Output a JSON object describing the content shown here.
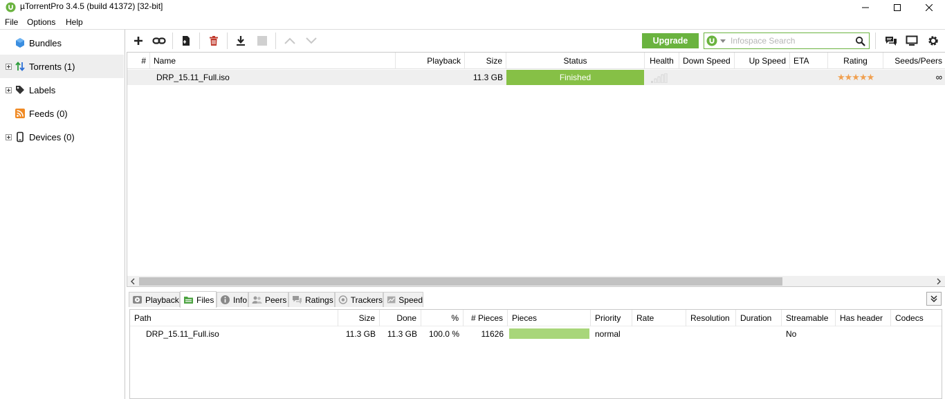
{
  "window": {
    "title": "µTorrentPro 3.4.5  (build 41372) [32-bit]",
    "controls": [
      "minimize",
      "maximize",
      "close"
    ]
  },
  "menu": [
    "File",
    "Options",
    "Help"
  ],
  "sidebar": {
    "items": [
      {
        "label": "Bundles",
        "icon": "bundles-icon"
      },
      {
        "label": "Torrents (1)",
        "icon": "torrents-icon"
      },
      {
        "label": "Labels",
        "icon": "labels-icon"
      },
      {
        "label": "Feeds (0)",
        "icon": "rss-icon"
      },
      {
        "label": "Devices (0)",
        "icon": "devices-icon"
      }
    ]
  },
  "toolbar": {
    "buttons": [
      "add-torrent",
      "add-from-url",
      "create-torrent",
      "remove",
      "start",
      "stop",
      "move-up",
      "move-down"
    ],
    "upgrade_label": "Upgrade",
    "search_placeholder": "Infospace Search",
    "right_icons": [
      "chat-icon",
      "remote-icon",
      "settings-icon"
    ]
  },
  "torrents": {
    "columns": [
      "#",
      "Name",
      "Playback",
      "Size",
      "Status",
      "Health",
      "Down Speed",
      "Up Speed",
      "ETA",
      "Rating",
      "Seeds/Peers"
    ],
    "rows": [
      {
        "num": "",
        "name": "DRP_15.11_Full.iso",
        "playback": "",
        "size": "11.3 GB",
        "status": "Finished",
        "health": "",
        "down": "",
        "up": "",
        "eta": "",
        "rating": "★★★★★",
        "seeds": "∞"
      }
    ],
    "status_color": "#86c046"
  },
  "tabs": [
    {
      "label": "Playback",
      "icon": "playback-icon"
    },
    {
      "label": "Files",
      "icon": "files-icon",
      "active": true
    },
    {
      "label": "Info",
      "icon": "info-icon"
    },
    {
      "label": "Peers",
      "icon": "peers-icon"
    },
    {
      "label": "Ratings",
      "icon": "ratings-icon"
    },
    {
      "label": "Trackers",
      "icon": "trackers-icon"
    },
    {
      "label": "Speed",
      "icon": "speed-icon"
    }
  ],
  "files": {
    "columns": [
      "Path",
      "Size",
      "Done",
      "%",
      "# Pieces",
      "Pieces",
      "Priority",
      "Rate",
      "Resolution",
      "Duration",
      "Streamable",
      "Has header",
      "Codecs"
    ],
    "rows": [
      {
        "path": "DRP_15.11_Full.iso",
        "size": "11.3 GB",
        "done": "11.3 GB",
        "pct": "100.0 %",
        "npieces": "11626",
        "pieces_fraction": 1.0,
        "priority": "normal",
        "rate": "",
        "resolution": "",
        "duration": "",
        "streamable": "No",
        "has_header": "",
        "codecs": ""
      }
    ]
  },
  "colors": {
    "brand_green": "#6ab33f",
    "finished_green": "#86c046",
    "pieces_green": "#a8d67a"
  }
}
